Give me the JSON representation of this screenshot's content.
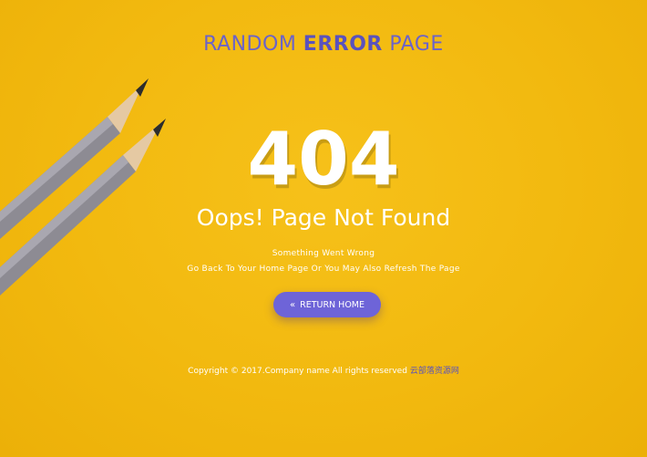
{
  "header": {
    "word1": "RANDOM",
    "word2": "ERROR",
    "word3": "PAGE"
  },
  "error": {
    "code": "404",
    "title": "Oops! Page Not Found",
    "message1": "Something Went Wrong",
    "message2": "Go Back To Your Home Page Or You May Also Refresh The Page"
  },
  "return_button": {
    "icon": "double-chevron-left-icon",
    "label": "RETURN HOME"
  },
  "footer": {
    "copyright": "Copyright © 2017.Company name All rights reserved",
    "link_text": "云部落资源网"
  },
  "colors": {
    "background": "#f2b90f",
    "accent": "#6e64d8",
    "header_text": "#6b63c9",
    "text": "#ffffff"
  }
}
